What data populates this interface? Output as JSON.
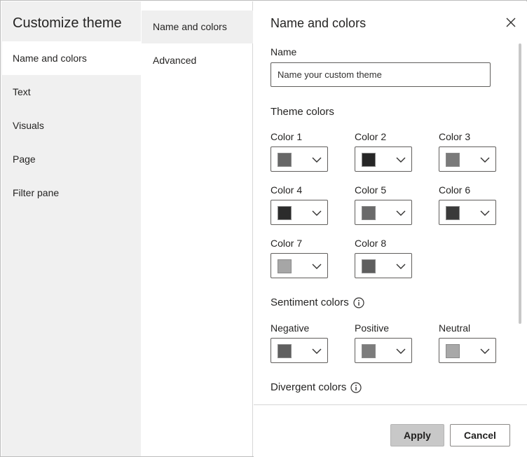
{
  "nav": {
    "title": "Customize theme",
    "items": [
      {
        "label": "Name and colors",
        "active": true
      },
      {
        "label": "Text",
        "active": false
      },
      {
        "label": "Visuals",
        "active": false
      },
      {
        "label": "Page",
        "active": false
      },
      {
        "label": "Filter pane",
        "active": false
      }
    ]
  },
  "subnav": {
    "items": [
      {
        "label": "Name and colors",
        "active": true
      },
      {
        "label": "Advanced",
        "active": false
      }
    ]
  },
  "main": {
    "title": "Name and colors",
    "close_icon": "close-icon",
    "name_label": "Name",
    "name_placeholder": "Name your custom theme",
    "name_value": "",
    "theme_colors_heading": "Theme colors",
    "theme_colors": [
      {
        "label": "Color 1",
        "swatch": "#676767"
      },
      {
        "label": "Color 2",
        "swatch": "#262626"
      },
      {
        "label": "Color 3",
        "swatch": "#7a7a7a"
      },
      {
        "label": "Color 4",
        "swatch": "#2b2b2b"
      },
      {
        "label": "Color 5",
        "swatch": "#6a6a6a"
      },
      {
        "label": "Color 6",
        "swatch": "#3a3a3a"
      },
      {
        "label": "Color 7",
        "swatch": "#a6a6a6"
      },
      {
        "label": "Color 8",
        "swatch": "#5e5e5e"
      }
    ],
    "sentiment_heading": "Sentiment colors",
    "sentiment_colors": [
      {
        "label": "Negative",
        "swatch": "#5f5f5f"
      },
      {
        "label": "Positive",
        "swatch": "#7c7c7c"
      },
      {
        "label": "Neutral",
        "swatch": "#a8a8a8"
      }
    ],
    "divergent_heading": "Divergent colors",
    "info_icon": "info-icon",
    "chevron_icon": "chevron-down-icon"
  },
  "footer": {
    "apply_label": "Apply",
    "cancel_label": "Cancel"
  }
}
